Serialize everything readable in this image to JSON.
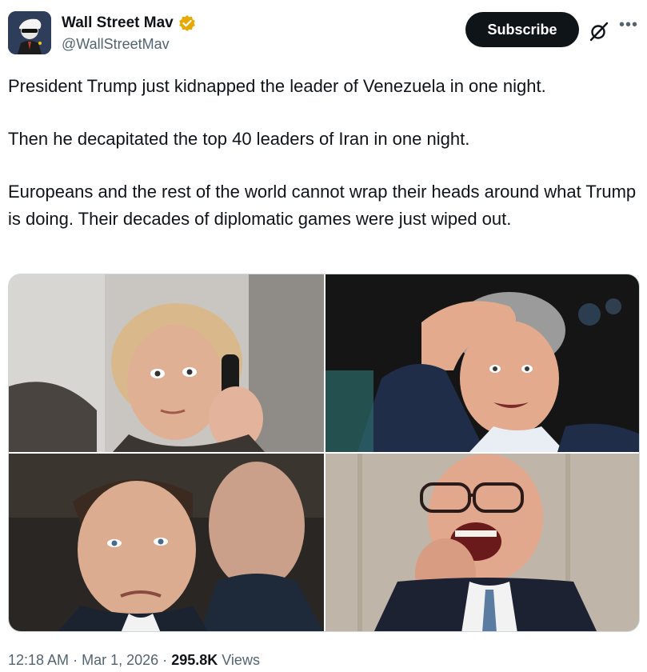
{
  "author": {
    "display_name": "Wall Street Mav",
    "handle": "@WallStreetMav",
    "verified": true,
    "verified_color": "#f4b400"
  },
  "actions": {
    "subscribe_label": "Subscribe",
    "grok_icon": "grok-icon",
    "more_icon": "more-icon"
  },
  "tweet": {
    "paragraphs": [
      "President Trump just kidnapped the leader of Venezuela in one night.",
      "Then he decapitated the top 40 leaders of Iran in one night.",
      "Europeans and the rest of the world cannot wrap their heads around what Trump is doing. Their decades of diplomatic games were just wiped out."
    ]
  },
  "media": {
    "photos": [
      "photo-woman-on-phone",
      "photo-man-hand-on-head",
      "photo-man-frowning",
      "photo-man-crying"
    ]
  },
  "meta": {
    "time": "12:18 AM",
    "date": "Mar 1, 2026",
    "views_count": "295.8K",
    "views_label": "Views",
    "separator": "·"
  }
}
